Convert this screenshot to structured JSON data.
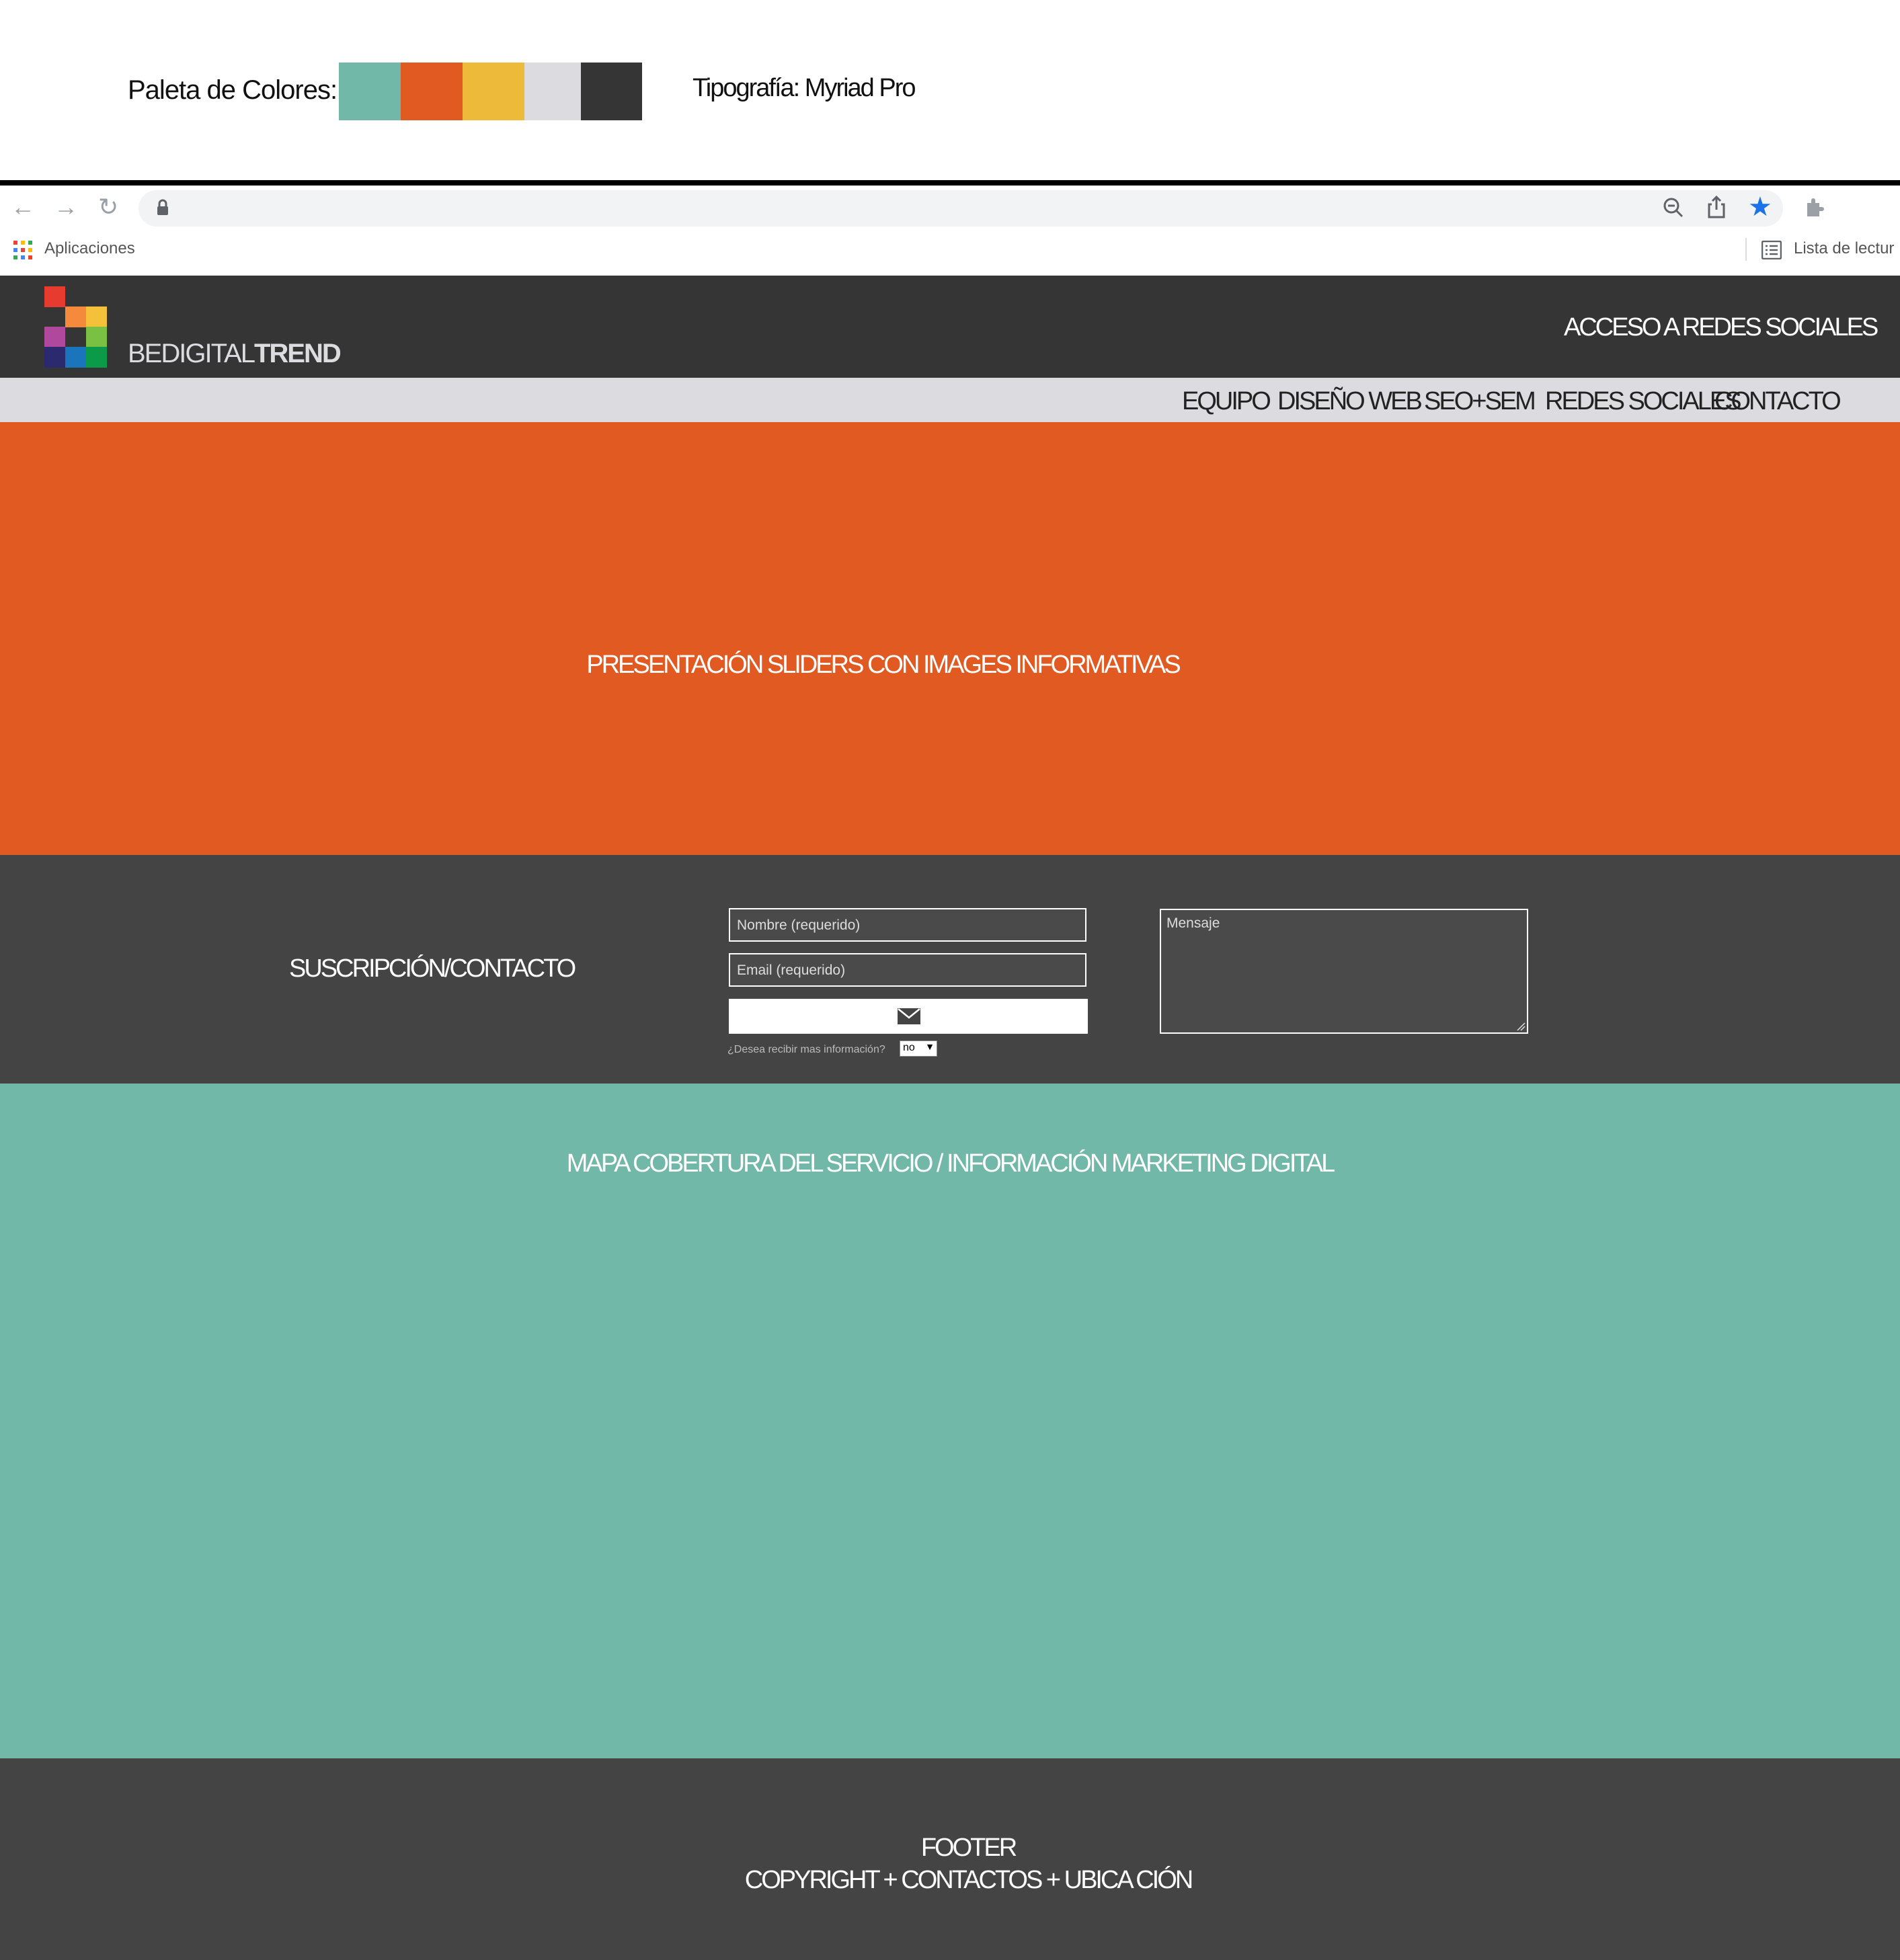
{
  "palette": {
    "label": "Paleta de Colores:",
    "colors": [
      "#72b8a8",
      "#e05a22",
      "#eeba3a",
      "#dcdce0",
      "#353535"
    ]
  },
  "typography_label": "Tipografía: Myriad Pro",
  "browser": {
    "bookmarks_apps": "Aplicaciones",
    "reading_list": "Lista de lectur",
    "icons": [
      "back-icon",
      "forward-icon",
      "reload-icon",
      "lock-icon",
      "zoom-out-icon",
      "share-icon",
      "star-icon",
      "extensions-icon",
      "menu-icon",
      "apps-grid-icon",
      "reading-list-icon"
    ]
  },
  "site": {
    "brand_light": "BEDIGITAL",
    "brand_bold": "TREND",
    "social_access": "ACCESO A REDES SOCIALES",
    "nav": [
      "EQUIPO",
      "DISEÑO WEB",
      "SEO+SEM",
      "REDES SOCIALES",
      "CONTACTO"
    ],
    "slider_text": "PRESENTACIÓN SLIDERS CON IMAGES INFORMATIVAS",
    "contact": {
      "title": "SUSCRIPCIÓN/CONTACTO",
      "name_placeholder": "Nombre (requerido)",
      "email_placeholder": "Email (requerido)",
      "message_placeholder": "Mensaje",
      "info_question": "¿Desea recibir mas información?",
      "info_value": "no"
    },
    "map_text": "MAPA COBERTURA DEL SERVICIO / INFORMACIÓN MARKETING DIGITAL",
    "footer_line1": "FOOTER",
    "footer_line2": "COPYRIGHT + CONTACTOS + UBICA CIÓN"
  }
}
